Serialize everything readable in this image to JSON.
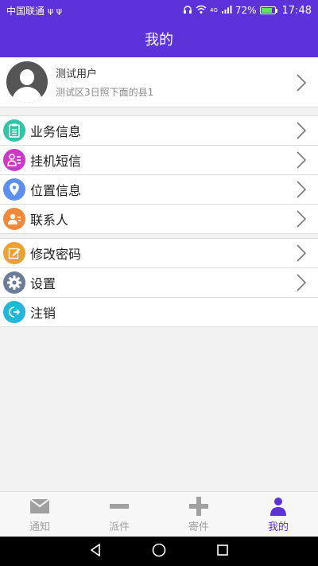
{
  "status_bar": {
    "carrier": "中国联通",
    "usb_icons": "ψ ψ",
    "battery_percent": "72%",
    "network": "4G",
    "time": "17:48"
  },
  "header": {
    "title": "我的"
  },
  "profile": {
    "user_name": "测试用户",
    "area": "测试区3日照下面的县1"
  },
  "menu": {
    "group1": [
      {
        "label": "业务信息",
        "icon": "clipboard-icon",
        "color": "#2ec7a4"
      },
      {
        "label": "挂机短信",
        "icon": "sms-icon",
        "color": "#cc38c7"
      },
      {
        "label": "位置信息",
        "icon": "location-pin-icon",
        "color": "#5b8ff0"
      },
      {
        "label": "联系人",
        "icon": "contact-icon",
        "color": "#f08a3a"
      }
    ],
    "group2": [
      {
        "label": "修改密码",
        "icon": "edit-icon",
        "color": "#f0a030"
      },
      {
        "label": "设置",
        "icon": "gear-icon",
        "color": "#6b7d99"
      },
      {
        "label": "注销",
        "icon": "logout-icon",
        "color": "#20b8d8"
      }
    ]
  },
  "bottom_nav": {
    "items": [
      {
        "label": "通知",
        "icon": "mail-icon"
      },
      {
        "label": "派件",
        "icon": "minus-icon"
      },
      {
        "label": "寄件",
        "icon": "plus-icon"
      },
      {
        "label": "我的",
        "icon": "person-icon"
      }
    ],
    "active_color": "#5b33d8",
    "inactive_color": "#a0a0a0"
  },
  "theme": {
    "primary": "#5b33d8"
  }
}
